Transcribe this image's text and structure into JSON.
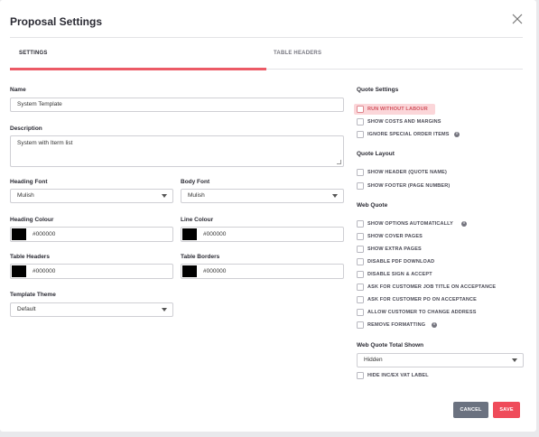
{
  "modal": {
    "title": "Proposal Settings"
  },
  "tabs": [
    {
      "label": "SETTINGS",
      "active": true
    },
    {
      "label": "TABLE HEADERS",
      "active": false
    }
  ],
  "form": {
    "name_label": "Name",
    "name_value": "System Template",
    "description_label": "Description",
    "description_value": "System with Iterm list",
    "heading_font_label": "Heading Font",
    "heading_font_value": "Mulish",
    "body_font_label": "Body Font",
    "body_font_value": "Mulish",
    "heading_colour_label": "Heading Colour",
    "heading_colour_value": "#000000",
    "line_colour_label": "Line Colour",
    "line_colour_value": "#000000",
    "table_headers_label": "Table Headers",
    "table_headers_value": "#000000",
    "table_borders_label": "Table Borders",
    "table_borders_value": "#000000",
    "template_theme_label": "Template Theme",
    "template_theme_value": "Default"
  },
  "quote_settings": {
    "heading": "Quote Settings",
    "options": [
      {
        "label": "RUN WITHOUT LABOUR",
        "checked": false,
        "highlighted": true
      },
      {
        "label": "SHOW COSTS AND MARGINS",
        "checked": false
      },
      {
        "label": "IGNORE SPECIAL ORDER ITEMS",
        "checked": false,
        "info": true
      }
    ]
  },
  "quote_layout": {
    "heading": "Quote Layout",
    "options": [
      {
        "label": "SHOW HEADER (QUOTE NAME)",
        "checked": false
      },
      {
        "label": "SHOW FOOTER (PAGE NUMBER)",
        "checked": false
      }
    ]
  },
  "web_quote": {
    "heading": "Web Quote",
    "options": [
      {
        "label": "SHOW OPTIONS AUTOMATICALLY",
        "checked": false,
        "info": true
      },
      {
        "label": "SHOW COVER PAGES",
        "checked": false
      },
      {
        "label": "SHOW EXTRA PAGES",
        "checked": false
      },
      {
        "label": "DISABLE PDF DOWNLOAD",
        "checked": false
      },
      {
        "label": "DISABLE SIGN & ACCEPT",
        "checked": false
      },
      {
        "label": "ASK FOR CUSTOMER JOB TITLE ON ACCEPTANCE",
        "checked": false
      },
      {
        "label": "ASK FOR CUSTOMER PO ON ACCEPTANCE",
        "checked": false
      },
      {
        "label": "ALLOW CUSTOMER TO CHANGE ADDRESS",
        "checked": false
      },
      {
        "label": "REMOVE FORMATTING",
        "checked": false,
        "info": true
      }
    ]
  },
  "web_quote_total": {
    "heading": "Web Quote Total Shown",
    "value": "Hidden",
    "hide_vat_label": "HIDE INC/EX VAT LABEL"
  },
  "info_glyph": "i",
  "buttons": {
    "cancel": "CANCEL",
    "save": "SAVE"
  },
  "colors": {
    "accent": "#ec5a66",
    "save": "#ef4b5a",
    "cancel": "#6b7280",
    "swatch": "#000000"
  },
  "icons": {
    "close": "close-icon",
    "caret": "chevron-down-icon",
    "info": "info-icon"
  }
}
